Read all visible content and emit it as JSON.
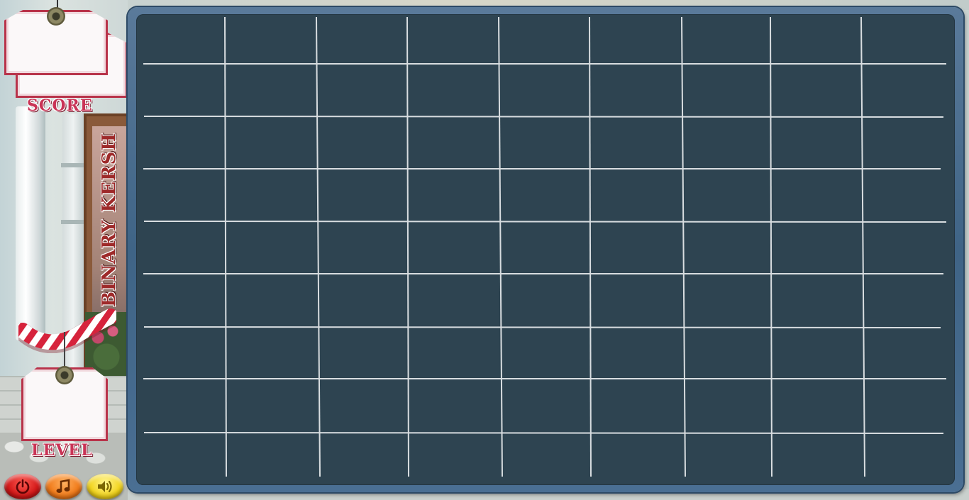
{
  "game": {
    "title": "BINARY KERSH",
    "score_label": "SCORE",
    "score_value": "",
    "level_label": "LEVEL",
    "level_value": ""
  },
  "controls": [
    {
      "name": "power-button",
      "icon": "power-icon"
    },
    {
      "name": "music-button",
      "icon": "music-note-icon"
    },
    {
      "name": "sound-button",
      "icon": "speaker-icon"
    }
  ],
  "board": {
    "columns": 9,
    "rows": 9,
    "cells": []
  },
  "colors": {
    "board_bg": "#2e4451",
    "grid_line": "#d8dde0",
    "frame": "#4a6f93",
    "accent_red": "#c93456"
  }
}
